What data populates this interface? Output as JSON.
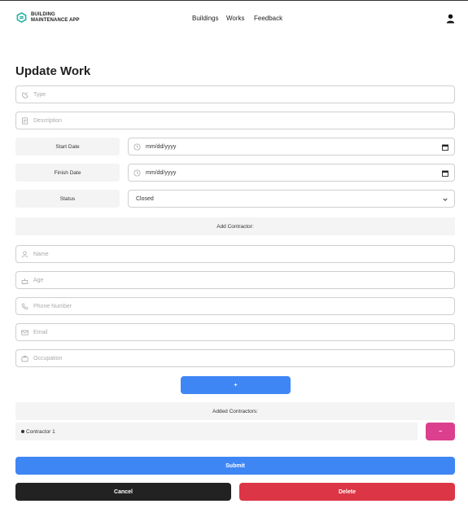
{
  "brand": {
    "line1": "BUILDING",
    "line2": "MAINTENANCE APP",
    "accent": "#2bb3a6"
  },
  "nav": {
    "items": [
      "Buildings",
      "Works",
      "Feedback"
    ]
  },
  "page": {
    "title": "Update Work"
  },
  "work": {
    "type_placeholder": "Type",
    "description_placeholder": "Description",
    "start_date_label": "Start Date",
    "start_date_value": "mm/dd/yyyy",
    "finish_date_label": "Finish Date",
    "finish_date_value": "mm/dd/yyyy",
    "status_label": "Status",
    "status_value": "Closed"
  },
  "add_contractor": {
    "heading": "Add Contractor:",
    "name_placeholder": "Name",
    "age_placeholder": "Age",
    "phone_placeholder": "Phone Number",
    "email_placeholder": "Email",
    "occupation_placeholder": "Occupation",
    "add_button": "+"
  },
  "added_contractors": {
    "heading": "Added Contractors:",
    "items": [
      "Contractor 1"
    ],
    "remove_button": "−"
  },
  "actions": {
    "submit": "Submit",
    "cancel": "Cancel",
    "delete": "Delete"
  },
  "colors": {
    "primary": "#3f86f5",
    "danger": "#dc3545",
    "dark": "#222222",
    "remove": "#dc3f8e"
  }
}
